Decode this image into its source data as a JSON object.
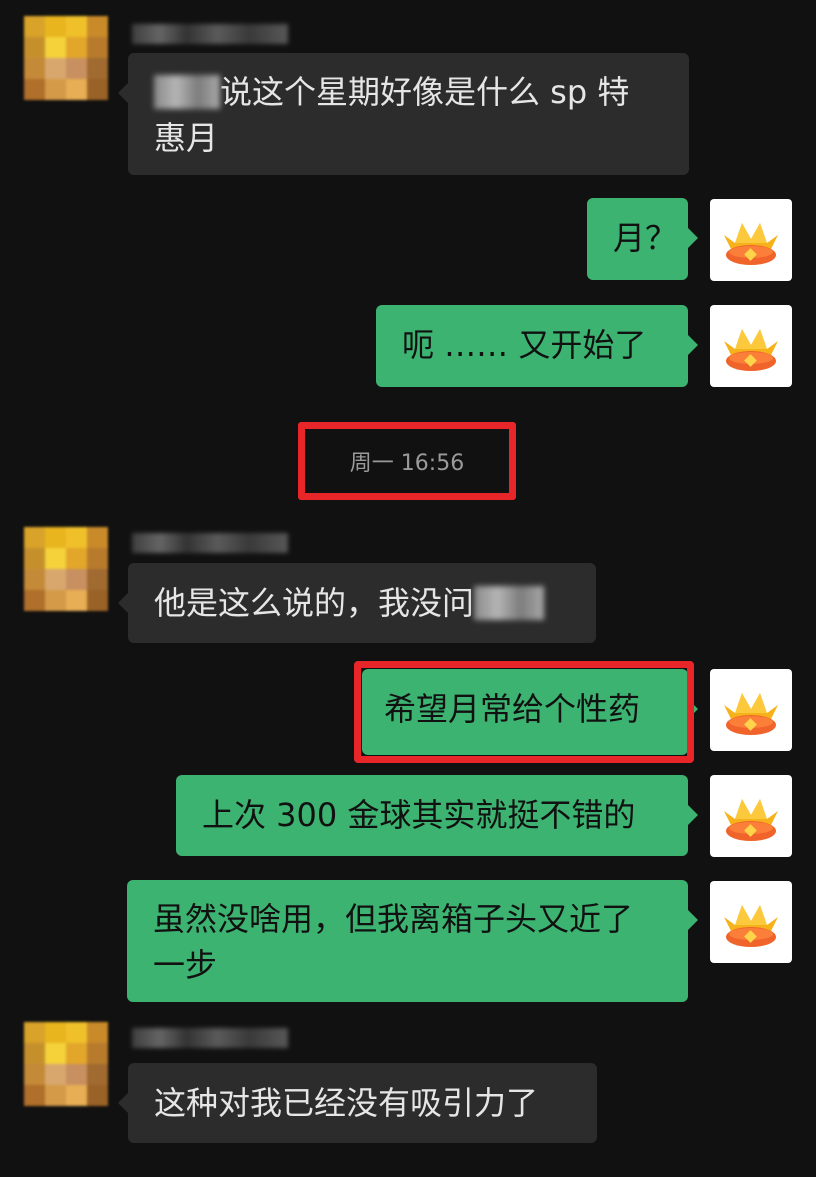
{
  "messages": {
    "m1": {
      "text_pre_redact": "",
      "text": "说这个星期好像是什么 sp 特",
      "text_line2": "惠月"
    },
    "m2": {
      "text": "月？"
    },
    "m3": {
      "text": "呃 …… 又开始了"
    },
    "timestamp": "周一 16:56",
    "m4": {
      "text": "他是这么说的，我没问"
    },
    "m5": {
      "text": "希望月常给个性药"
    },
    "m6": {
      "text": "上次 300 金球其实就挺不错的"
    },
    "m7": {
      "text": "虽然没啥用，但我离箱子头又近了",
      "text_line2": "一步"
    },
    "m8": {
      "text": "这种对我已经没有吸引力了"
    }
  },
  "colors": {
    "background": "#111111",
    "incoming_bubble": "#2c2c2c",
    "outgoing_bubble": "#3cb371",
    "highlight_red": "#e8262a"
  },
  "icons": {
    "contact_avatar": "pixelated-avatar",
    "self_avatar": "crown-icon"
  }
}
